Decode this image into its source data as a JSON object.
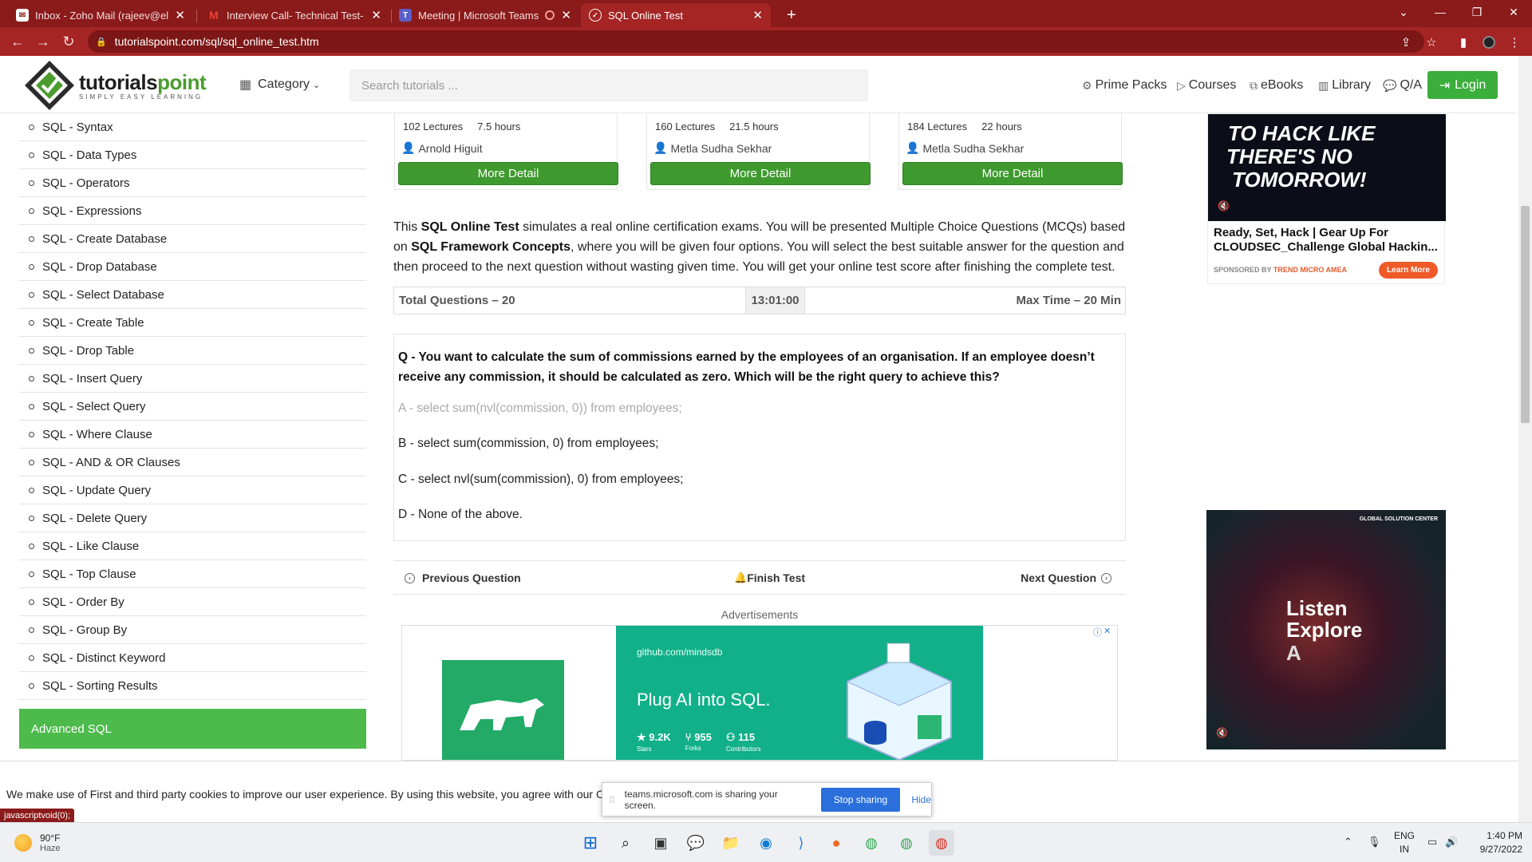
{
  "browser": {
    "tabs": [
      {
        "title": "Inbox - Zoho Mail (rajeev@electr",
        "icon": "mail-icon",
        "active": false
      },
      {
        "title": "Interview Call- Technical Test- La",
        "icon": "gmail-icon",
        "active": false
      },
      {
        "title": "Meeting | Microsoft Teams",
        "icon": "teams-icon",
        "active": false
      },
      {
        "title": "SQL Online Test",
        "icon": "tutorialspoint-icon",
        "active": true
      }
    ],
    "new_tab": "+",
    "url": "tutorialspoint.com/sql/sql_online_test.htm"
  },
  "header": {
    "logo_brand_a": "tutorials",
    "logo_brand_b": "point",
    "logo_tagline": "SIMPLY EASY LEARNING",
    "category_label": "Category",
    "search_placeholder": "Search tutorials ...",
    "nav": {
      "prime_packs": "Prime Packs",
      "courses": "Courses",
      "ebooks": "eBooks",
      "library": "Library",
      "qa": "Q/A",
      "login": "Login"
    }
  },
  "sidebar": {
    "items": [
      "SQL - Syntax",
      "SQL - Data Types",
      "SQL - Operators",
      "SQL - Expressions",
      "SQL - Create Database",
      "SQL - Drop Database",
      "SQL - Select Database",
      "SQL - Create Table",
      "SQL - Drop Table",
      "SQL - Insert Query",
      "SQL - Select Query",
      "SQL - Where Clause",
      "SQL - AND & OR Clauses",
      "SQL - Update Query",
      "SQL - Delete Query",
      "SQL - Like Clause",
      "SQL - Top Clause",
      "SQL - Order By",
      "SQL - Group By",
      "SQL - Distinct Keyword",
      "SQL - Sorting Results"
    ],
    "section": "Advanced SQL"
  },
  "courses": [
    {
      "lectures": "102 Lectures",
      "hours": "7.5 hours",
      "author": "Arnold Higuit",
      "button": "More Detail"
    },
    {
      "lectures": "160 Lectures",
      "hours": "21.5 hours",
      "author": "Metla Sudha Sekhar",
      "button": "More Detail"
    },
    {
      "lectures": "184 Lectures",
      "hours": "22 hours",
      "author": "Metla Sudha Sekhar",
      "button": "More Detail"
    }
  ],
  "intro": {
    "p1": "This ",
    "b1": "SQL Online Test",
    "p2": " simulates a real online certification exams. You will be presented Multiple Choice Questions (MCQs) based on ",
    "b2": "SQL Framework Concepts",
    "p3": ", where you will be given four options. You will select the best suitable answer for the question and then proceed to the next question without wasting given time. You will get your online test score after finishing the complete test."
  },
  "test": {
    "total_questions": "Total Questions – 20",
    "timer": "13:01:00",
    "max_time": "Max Time – 20 Min",
    "question": "Q - You want to calculate the sum of commissions earned by the employees of an organisation. If an employee doesn’t receive any commission, it should be calculated as zero. Which will be the right query to achieve this?",
    "options": [
      "A - select sum(nvl(commission, 0)) from employees;",
      "B - select sum(commission, 0) from employees;",
      "C - select nvl(sum(commission), 0) from employees;",
      "D - None of the above."
    ],
    "prev": "Previous Question",
    "finish": "Finish Test",
    "next": "Next Question"
  },
  "ads": {
    "label": "Advertisements",
    "banner": {
      "url_a": "github.com/",
      "url_b": "mindsdb",
      "headline": "Plug AI into SQL.",
      "stars": "9.2K",
      "stars_label": "Stars",
      "forks": "955",
      "forks_label": "Forks",
      "contributors": "115",
      "contributors_label": "Contributors"
    },
    "right1": {
      "line1": "TO HACK LIKE",
      "line2": "THERE'S NO",
      "line3": "TOMORROW!",
      "title": "Ready, Set, Hack | Gear Up For CLOUDSEC_Challenge Global Hackin...",
      "sponsor_prefix": "SPONSORED BY ",
      "sponsor": "TREND MICRO AMEA",
      "cta": "Learn More"
    },
    "right2": {
      "line1": "Listen",
      "line2": "Explore",
      "line3": "A",
      "brand": "GLOBAL SOLUTION CENTER"
    }
  },
  "cookie": {
    "message": "We make use of First and third party cookies to improve our user experience. By using this website, you agree with our C"
  },
  "sharing": {
    "text": "teams.microsoft.com is sharing your screen.",
    "stop": "Stop sharing",
    "hide": "Hide"
  },
  "status_tip": "javascriptvoid(0);",
  "taskbar": {
    "temp": "90°F",
    "condition": "Haze",
    "lang1": "ENG",
    "lang2": "IN",
    "time": "1:40 PM",
    "date": "9/27/2022"
  },
  "colors": {
    "browser_frame": "#8b1a1a",
    "accent_green": "#3e9a2e",
    "sidebar_section": "#4cbb4c",
    "share_blue": "#2a6fdb"
  }
}
